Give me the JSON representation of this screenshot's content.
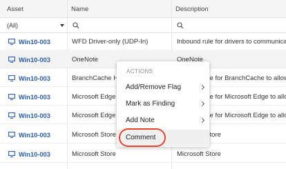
{
  "columns": {
    "asset": "Asset",
    "name": "Name",
    "description": "Description"
  },
  "filters": {
    "asset_value": "(All)",
    "asset_caret": "chevron-down-icon",
    "name_icon": "search-icon",
    "desc_icon": "search-icon"
  },
  "rows": [
    {
      "asset": "Win10-003",
      "name": "WFD Driver-only (UDP-In)",
      "description": "Inbound rule for drivers to communicate"
    },
    {
      "asset": "Win10-003",
      "name": "OneNote",
      "description": "OneNote"
    },
    {
      "asset": "Win10-003",
      "name": "BranchCache H",
      "description": "Inbound rule for BranchCache to allow"
    },
    {
      "asset": "Win10-003",
      "name": "Microsoft Edge",
      "description": "Inbound rule for Microsoft Edge to allow"
    },
    {
      "asset": "Win10-003",
      "name": "Microsoft Edge",
      "description": "Inbound rule for Microsoft Edge to allow"
    },
    {
      "asset": "Win10-003",
      "name": "Microsoft Store",
      "description": "Microsoft Store"
    },
    {
      "asset": "Win10-003",
      "name": "Microsoft Store",
      "description": "Microsoft Store"
    }
  ],
  "menu": {
    "heading": "ACTIONS",
    "items": [
      {
        "label": "Add/Remove Flag",
        "submenu": true
      },
      {
        "label": "Mark as Finding",
        "submenu": true
      },
      {
        "label": "Add Note",
        "submenu": true
      },
      {
        "label": "Comment",
        "submenu": false
      }
    ]
  },
  "colors": {
    "asset_link": "#2a5db0",
    "highlight_ring": "#e2452c",
    "header_bg": "#f5f5f5",
    "alt_row_bg": "#f3f3f3"
  }
}
